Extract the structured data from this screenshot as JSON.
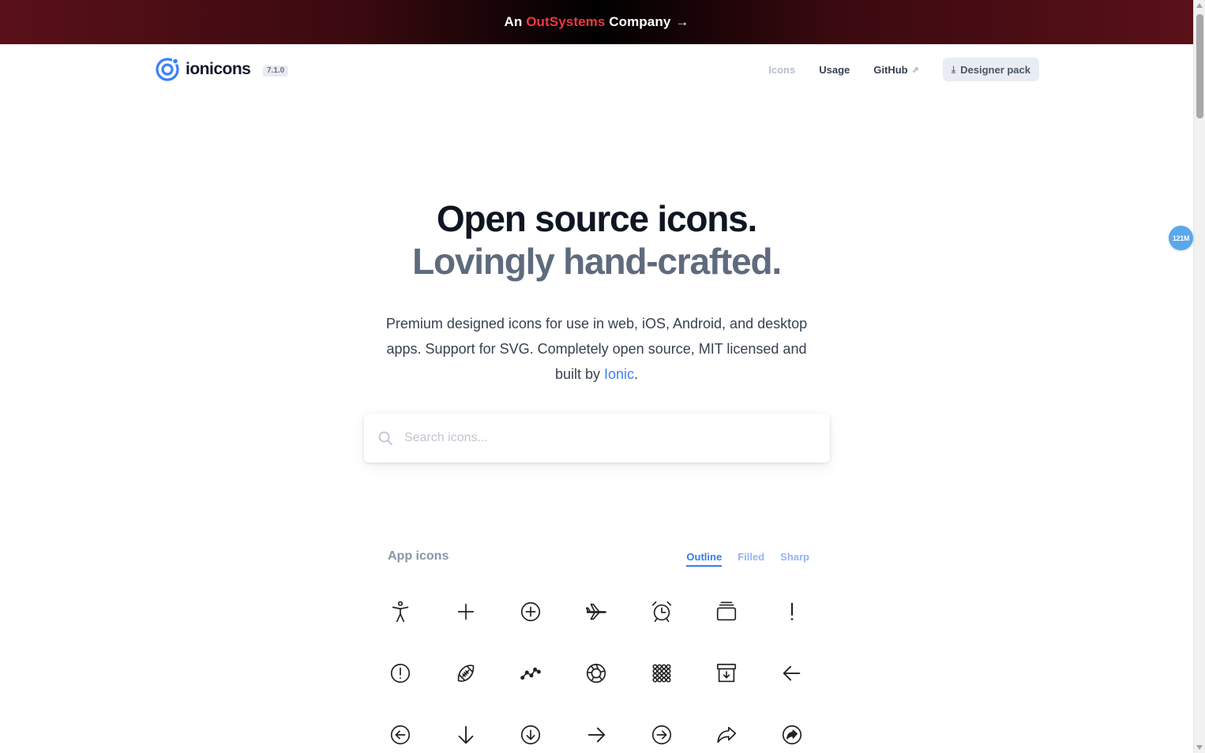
{
  "banner": {
    "prefix": "An",
    "brand": "OutSystems",
    "suffix": "Company",
    "arrow": "→"
  },
  "nav": {
    "logo_text": "ionicons",
    "version": "7.1.0",
    "links": [
      {
        "label": "Icons",
        "active": true
      },
      {
        "label": "Usage",
        "active": false
      },
      {
        "label": "GitHub",
        "external_icon": "external-link-icon"
      }
    ],
    "designer_pack": {
      "label": "Designer pack",
      "icon": "download-icon"
    }
  },
  "hero": {
    "title": "Open source icons.",
    "subtitle": "Lovingly hand-crafted.",
    "description_before": "Premium designed icons for use in web, iOS, Android, and desktop apps. Support for SVG. Completely open source, MIT licensed and built by ",
    "description_link": "Ionic",
    "description_after": "."
  },
  "search": {
    "placeholder": "Search icons..."
  },
  "icons_section": {
    "title": "App icons",
    "tabs": [
      {
        "label": "Outline",
        "active": true
      },
      {
        "label": "Filled",
        "active": false
      },
      {
        "label": "Sharp",
        "active": false
      }
    ],
    "rows": [
      [
        "accessibility-icon",
        "add-icon",
        "add-circle-icon",
        "airplane-icon",
        "alarm-icon",
        "albums-icon",
        "alert-icon"
      ],
      [
        "alert-circle-icon",
        "american-football-icon",
        "analytics-icon",
        "aperture-icon",
        "apps-icon",
        "archive-icon",
        "arrow-back-icon"
      ],
      [
        "arrow-back-circle-icon",
        "arrow-down-icon",
        "arrow-down-circle-icon",
        "arrow-forward-icon",
        "arrow-forward-circle-icon",
        "arrow-redo-icon",
        "arrow-redo-circle-icon"
      ]
    ]
  },
  "floating_badge": "121M",
  "colors": {
    "accent": "#3b82f6",
    "brand_red": "#f0383f",
    "title": "#0f1623",
    "subtitle": "#5f6b7d"
  }
}
